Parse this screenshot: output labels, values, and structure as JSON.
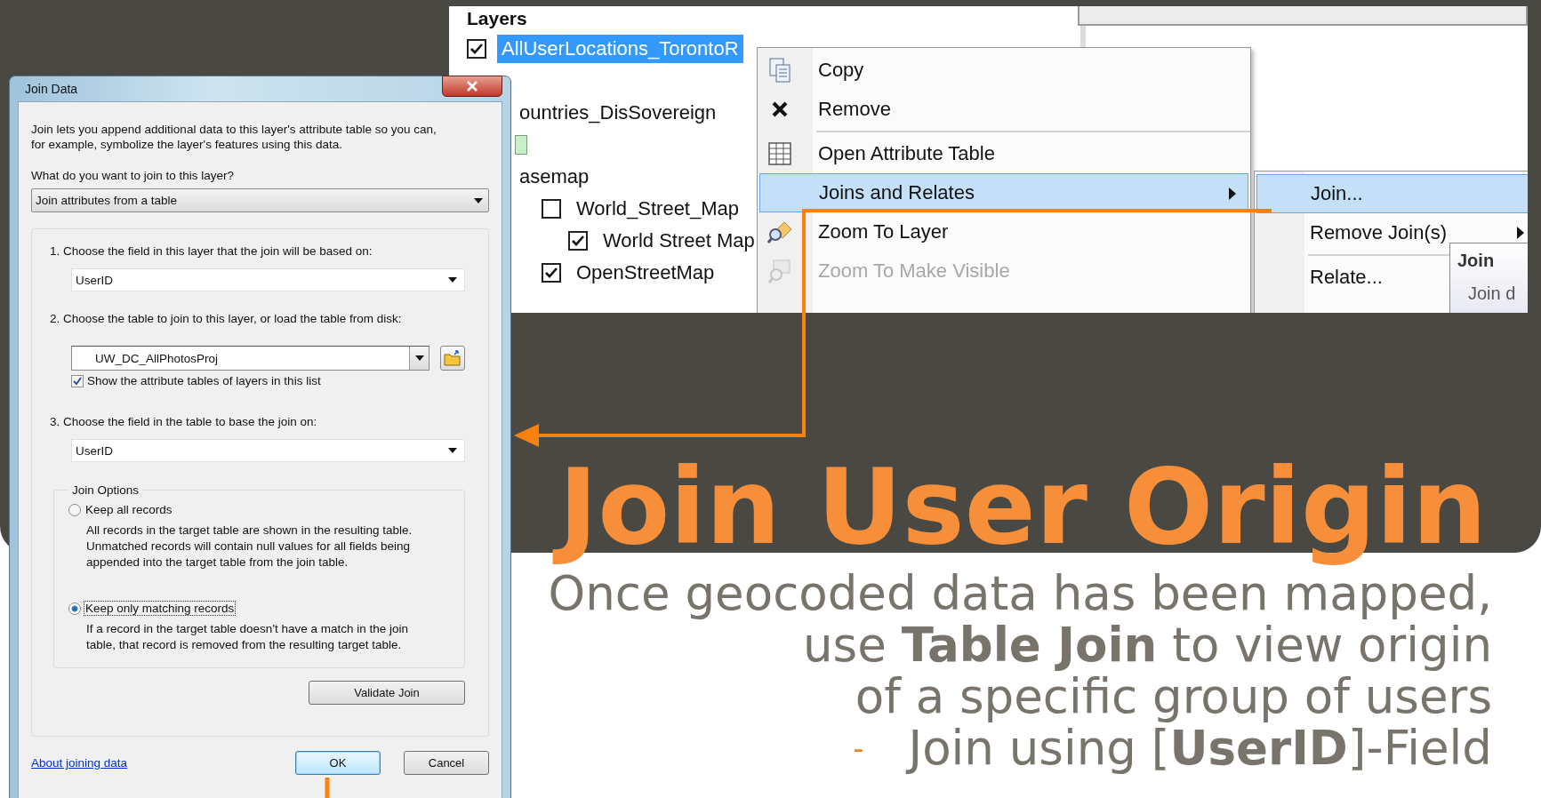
{
  "layers_panel": {
    "title": "Layers",
    "items": [
      {
        "label": "AllUserLocations_TorontoR",
        "checked": true,
        "selected": true
      },
      {
        "label": "ountries_DisSovereign",
        "selected": false,
        "legend": true
      },
      {
        "label": "asemap",
        "selected": false,
        "children": [
          {
            "label": "World_Street_Map",
            "checked": false,
            "selected": false,
            "children": [
              {
                "label": "World Street Map",
                "checked": true,
                "selected": false
              }
            ]
          },
          {
            "label": "OpenStreetMap",
            "checked": true,
            "selected": false
          }
        ]
      }
    ]
  },
  "context_menu": {
    "groups": [
      [
        {
          "label": "Copy",
          "selected": false,
          "disabled": false,
          "submenu": false
        },
        {
          "label": "Remove",
          "selected": false,
          "disabled": false,
          "submenu": false
        }
      ],
      [
        {
          "label": "Open Attribute Table",
          "selected": false,
          "disabled": false,
          "submenu": false
        },
        {
          "label": "Joins and Relates",
          "selected": true,
          "disabled": false,
          "submenu": true
        },
        {
          "label": "Zoom To Layer",
          "selected": false,
          "disabled": false,
          "submenu": false
        },
        {
          "label": "Zoom To Make Visible",
          "selected": false,
          "disabled": true,
          "submenu": false
        }
      ]
    ]
  },
  "submenu": {
    "groups": [
      [
        {
          "label": "Join...",
          "selected": true,
          "submenu": false
        },
        {
          "label": "Remove Join(s)",
          "selected": false,
          "submenu": true
        }
      ],
      [
        {
          "label": "Relate...",
          "selected": false,
          "submenu": false
        }
      ]
    ]
  },
  "tooltip": {
    "title": "Join",
    "text": "Join d"
  },
  "dialog": {
    "title": "Join Data",
    "intro": [
      "Join lets you append additional data to this layer's attribute table so you can,",
      "for example, symbolize the layer's features using this data."
    ],
    "question": "What do you want to join to this layer?",
    "join_type": "Join attributes from a table",
    "steps": [
      {
        "number": "1.",
        "label": "Choose the field in this layer that the join will be based on:",
        "value": "UserID",
        "kind": "dropdown"
      },
      {
        "number": "2.",
        "label": "Choose the table to join to this layer, or load the table from disk:",
        "value": "UW_DC_AllPhotosProj",
        "kind": "table",
        "checkbox": {
          "label": "Show the attribute tables of layers in this list",
          "checked": true
        }
      },
      {
        "number": "3.",
        "label": "Choose the field in the table to base the join on:",
        "value": "UserID",
        "kind": "dropdown"
      }
    ],
    "join_options": {
      "title": "Join Options",
      "options": [
        {
          "label": "Keep all records",
          "selected": false,
          "description": [
            "All records in the target table are shown in the resulting table.",
            "Unmatched records will contain null values for all fields being",
            "appended into the target table from the join table."
          ]
        },
        {
          "label": "Keep only matching records",
          "selected": true,
          "description": [
            "If a record in the target table doesn't have a match in the join",
            "table, that record is removed from the resulting target table."
          ]
        }
      ]
    },
    "validate_button": "Validate Join",
    "help_link": "About joining data",
    "buttons": [
      {
        "label": "OK",
        "focused": true
      },
      {
        "label": "Cancel",
        "focused": false
      }
    ]
  },
  "slide": {
    "title": "Join User Origin",
    "body_lines": [
      "Once geocoded data has been mapped,",
      "use **Table Join** to view origin",
      "of a specific group of users"
    ],
    "bullets": [
      {
        "marker": "-",
        "text": "Join using [**UserID**]-Field"
      }
    ]
  }
}
